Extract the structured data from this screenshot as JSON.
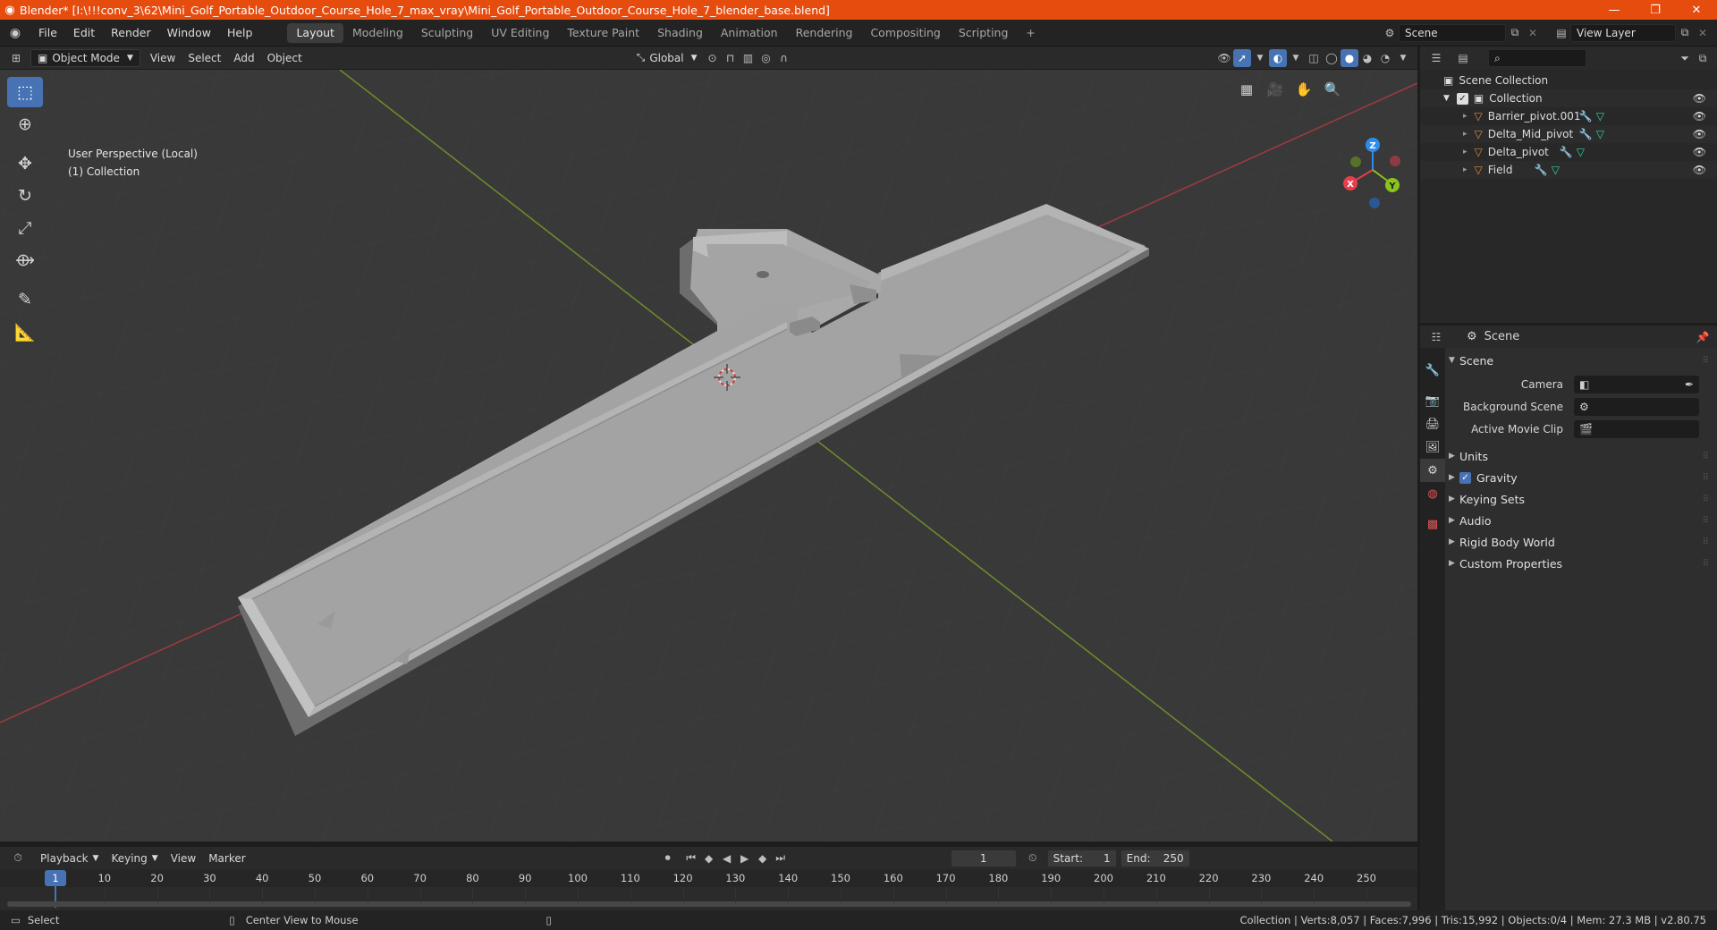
{
  "titlebar": {
    "title": "Blender* [I:\\!!!conv_3\\62\\Mini_Golf_Portable_Outdoor_Course_Hole_7_max_vray\\Mini_Golf_Portable_Outdoor_Course_Hole_7_blender_base.blend]",
    "minimize": "—",
    "restore": "❐",
    "close": "✕"
  },
  "menu": [
    "File",
    "Edit",
    "Render",
    "Window",
    "Help"
  ],
  "workspaces": [
    "Layout",
    "Modeling",
    "Sculpting",
    "UV Editing",
    "Texture Paint",
    "Shading",
    "Animation",
    "Rendering",
    "Compositing",
    "Scripting"
  ],
  "workspace_add": "+",
  "scene_field": "Scene",
  "viewlayer_field": "View Layer",
  "viewport_header": {
    "mode": "Object Mode",
    "menus": [
      "View",
      "Select",
      "Add",
      "Object"
    ],
    "transform": "Global"
  },
  "viewport": {
    "perspective": "User Perspective (Local)",
    "collection": "(1) Collection",
    "gizmo": {
      "x": "X",
      "y": "Y",
      "z": "Z"
    }
  },
  "timeline": {
    "menus": [
      "Playback",
      "Keying",
      "View",
      "Marker"
    ],
    "current_frame": "1",
    "start_label": "Start:",
    "start": "1",
    "end_label": "End:",
    "end": "250",
    "ticks": [
      "1",
      "10",
      "20",
      "30",
      "40",
      "50",
      "60",
      "70",
      "80",
      "90",
      "100",
      "110",
      "120",
      "130",
      "140",
      "150",
      "160",
      "170",
      "180",
      "190",
      "200",
      "210",
      "220",
      "230",
      "240",
      "250"
    ]
  },
  "statusbar": {
    "left1": "Select",
    "left2": "Center View to Mouse",
    "right": "Collection | Verts:8,057 | Faces:7,996 | Tris:15,992 | Objects:0/4 | Mem: 27.3 MB | v2.80.75"
  },
  "outliner": {
    "root": "Scene Collection",
    "collection": "Collection",
    "objects": [
      "Barrier_pivot.001",
      "Delta_Mid_pivot",
      "Delta_pivot",
      "Field"
    ]
  },
  "properties": {
    "header": "Scene",
    "panel": "Scene",
    "fields": [
      {
        "label": "Camera",
        "value": ""
      },
      {
        "label": "Background Scene",
        "value": ""
      },
      {
        "label": "Active Movie Clip",
        "value": ""
      }
    ],
    "subpanels": [
      "Units",
      "Gravity",
      "Keying Sets",
      "Audio",
      "Rigid Body World",
      "Custom Properties"
    ]
  },
  "colors": {
    "accent": "#4772b3",
    "titlebar": "#e74c0f",
    "x_axis": "#e83d4d",
    "y_axis": "#8bc21c",
    "z_axis": "#2c8cf0"
  }
}
